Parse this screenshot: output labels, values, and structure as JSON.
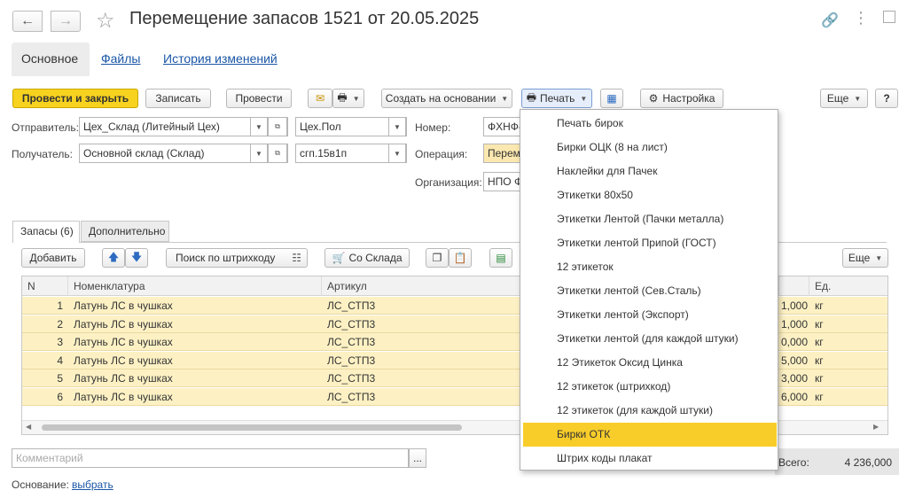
{
  "header": {
    "title": "Перемещение запасов 1521 от 20.05.2025"
  },
  "top_tabs": [
    "Основное",
    "Файлы",
    "История изменений"
  ],
  "toolbar": {
    "post_close": "Провести и закрыть",
    "save": "Записать",
    "post": "Провести",
    "create_based": "Создать на основании",
    "print": "Печать",
    "settings": "Настройка",
    "more": "Еще",
    "help": "?"
  },
  "form": {
    "sender_label": "Отправитель:",
    "sender_value": "Цех_Склад (Литейный Цех)",
    "sender_cell": "Цех.Пол",
    "receiver_label": "Получатель:",
    "receiver_value": "Основной склад (Склад)",
    "receiver_cell": "сгп.15в1п",
    "number_label": "Номер:",
    "number_value": "ФХНФ-",
    "operation_label": "Операция:",
    "operation_value": "Переме",
    "org_label": "Организация:",
    "org_value": "НПО Ф"
  },
  "inner_tabs": [
    "Запасы (6)",
    "Дополнительно"
  ],
  "table_toolbar": {
    "add": "Добавить",
    "barcode_search": "Поиск по штрихкоду",
    "from_warehouse": "Со Склада",
    "more": "Еще"
  },
  "table": {
    "columns": [
      "N",
      "Номенклатура",
      "Артикул",
      "Ед."
    ],
    "rows": [
      {
        "n": "1",
        "name": "Латунь ЛС в чушках",
        "article": "ЛС_СТП3",
        "qty": "1,000",
        "unit": "кг"
      },
      {
        "n": "2",
        "name": "Латунь ЛС в чушках",
        "article": "ЛС_СТП3",
        "qty": "1,000",
        "unit": "кг"
      },
      {
        "n": "3",
        "name": "Латунь ЛС в чушках",
        "article": "ЛС_СТП3",
        "qty": "0,000",
        "unit": "кг"
      },
      {
        "n": "4",
        "name": "Латунь ЛС в чушках",
        "article": "ЛС_СТП3",
        "qty": "5,000",
        "unit": "кг"
      },
      {
        "n": "5",
        "name": "Латунь ЛС в чушках",
        "article": "ЛС_СТП3",
        "qty": "3,000",
        "unit": "кг"
      },
      {
        "n": "6",
        "name": "Латунь ЛС в чушках",
        "article": "ЛС_СТП3",
        "qty": "6,000",
        "unit": "кг"
      }
    ]
  },
  "footer": {
    "comment_placeholder": "Комментарий",
    "comment_btn": "...",
    "total_label": "Всего:",
    "total_value": "4 236,000",
    "basis_label": "Основание:",
    "basis_link": "выбрать"
  },
  "print_menu": {
    "items": [
      "Печать бирок",
      "Бирки ОЦК (8 на лист)",
      "Наклейки для Пачек",
      "Этикетки 80х50",
      "Этикетки Лентой (Пачки металла)",
      "Этикетки лентой Припой (ГОСТ)",
      "12 этикеток",
      "Этикетки лентой (Сев.Сталь)",
      "Этикетки лентой (Экспорт)",
      "Этикетки лентой (для каждой штуки)",
      "12 Этикеток Оксид Цинка",
      "12 этикеток (штрихкод)",
      "12 этикеток (для каждой штуки)",
      "Бирки ОТК",
      "Штрих коды плакат"
    ],
    "selected_index": 13
  },
  "colors": {
    "accent_yellow": "#f7d21e",
    "row_yellow": "#fdf1c4",
    "link_blue": "#1a56a6"
  }
}
